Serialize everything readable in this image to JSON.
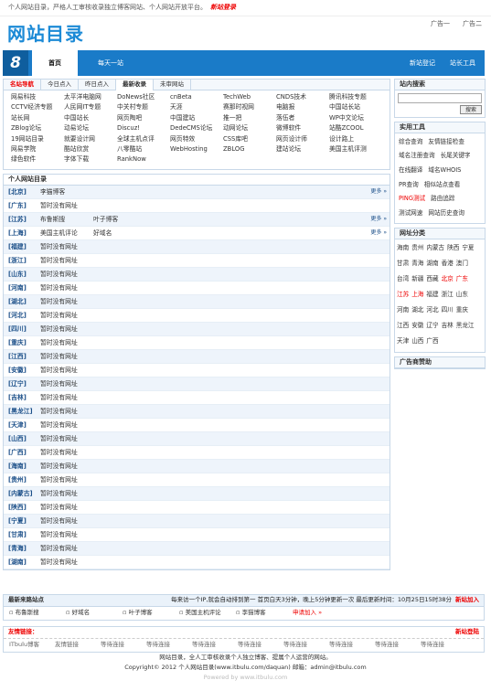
{
  "topbar": {
    "text": "个人网站目录，严格人工审核收录独立博客网站、个人网站开放平台。",
    "login": "新站登录"
  },
  "header": {
    "logo": "网站目录",
    "ad1": "广告一",
    "ad2": "广告二"
  },
  "nav": {
    "num": "8",
    "home": "首页",
    "daily": "每天一站",
    "submit": "新站登记",
    "tools": "站长工具"
  },
  "tabs": [
    "名站导航",
    "今日点入",
    "昨日点入",
    "最新收录",
    "未审网站"
  ],
  "famous": [
    "网易科技",
    "太平洋电脑网",
    "DoNews社区",
    "cnBeta",
    "TechWeb",
    "CNDS技术",
    "腾讯科技专题",
    "CCTV经济专题",
    "人民网IT专题",
    "中关村专题",
    "天涯",
    "赛那时视网",
    "电脑报",
    "中国站长站",
    "站长网",
    "中国站长",
    "网页陶吧",
    "中国建站",
    "推一把",
    "落伍者",
    "WP中文论坛",
    "ZBlog论坛",
    "动易论坛",
    "Discuz!",
    "DedeCMS论坛",
    "动网论坛",
    "微博软件",
    "站酷ZCOOL",
    "19网站目录",
    "就要设计网",
    "全球主机点评",
    "网页特效",
    "CSS库吧",
    "网页设计师",
    "设计路上",
    "网易学院",
    "酷站欣赏",
    "八零酷站",
    "WebHosting",
    "ZBLOG",
    "建站论坛",
    "美国主机评测",
    "绿色软件",
    "字体下载",
    "RankNow"
  ],
  "personal": {
    "title": "个人网站目录",
    "more": "更多 »",
    "rows": [
      {
        "p": "[北京]",
        "sites": [
          "李猫博客"
        ],
        "more": true
      },
      {
        "p": "[广东]",
        "sites": [
          "暂时没有网址"
        ],
        "more": false
      },
      {
        "p": "[江苏]",
        "sites": [
          "布鲁斯搜",
          "叶子博客"
        ],
        "more": true
      },
      {
        "p": "[上海]",
        "sites": [
          "美国主机评论",
          "好域名"
        ],
        "more": true
      },
      {
        "p": "[福建]",
        "sites": [
          "暂时没有网址"
        ],
        "more": false
      },
      {
        "p": "[浙江]",
        "sites": [
          "暂时没有网址"
        ],
        "more": false
      },
      {
        "p": "[山东]",
        "sites": [
          "暂时没有网址"
        ],
        "more": false
      },
      {
        "p": "[河南]",
        "sites": [
          "暂时没有网址"
        ],
        "more": false
      },
      {
        "p": "[湖北]",
        "sites": [
          "暂时没有网址"
        ],
        "more": false
      },
      {
        "p": "[河北]",
        "sites": [
          "暂时没有网址"
        ],
        "more": false
      },
      {
        "p": "[四川]",
        "sites": [
          "暂时没有网址"
        ],
        "more": false
      },
      {
        "p": "[重庆]",
        "sites": [
          "暂时没有网址"
        ],
        "more": false
      },
      {
        "p": "[江西]",
        "sites": [
          "暂时没有网址"
        ],
        "more": false
      },
      {
        "p": "[安徽]",
        "sites": [
          "暂时没有网址"
        ],
        "more": false
      },
      {
        "p": "[辽宁]",
        "sites": [
          "暂时没有网址"
        ],
        "more": false
      },
      {
        "p": "[吉林]",
        "sites": [
          "暂时没有网址"
        ],
        "more": false
      },
      {
        "p": "[黑龙江]",
        "sites": [
          "暂时没有网址"
        ],
        "more": false
      },
      {
        "p": "[天津]",
        "sites": [
          "暂时没有网址"
        ],
        "more": false
      },
      {
        "p": "[山西]",
        "sites": [
          "暂时没有网址"
        ],
        "more": false
      },
      {
        "p": "[广西]",
        "sites": [
          "暂时没有网址"
        ],
        "more": false
      },
      {
        "p": "[海南]",
        "sites": [
          "暂时没有网址"
        ],
        "more": false
      },
      {
        "p": "[贵州]",
        "sites": [
          "暂时没有网址"
        ],
        "more": false
      },
      {
        "p": "[内蒙古]",
        "sites": [
          "暂时没有网址"
        ],
        "more": false
      },
      {
        "p": "[陕西]",
        "sites": [
          "暂时没有网址"
        ],
        "more": false
      },
      {
        "p": "[宁夏]",
        "sites": [
          "暂时没有网址"
        ],
        "more": false
      },
      {
        "p": "[甘肃]",
        "sites": [
          "暂时没有网址"
        ],
        "more": false
      },
      {
        "p": "[青海]",
        "sites": [
          "暂时没有网址"
        ],
        "more": false
      },
      {
        "p": "[湖南]",
        "sites": [
          "暂时没有网址"
        ],
        "more": false
      }
    ]
  },
  "newsite": {
    "title": "最新来路站点",
    "scroll": "每来访一个IP,就会自动排到第一 首页白天3分钟，晚上5分钟更新一次 最后更新时间：10月25日15时38分",
    "add": "新站加入",
    "items": [
      "布鲁斯搜",
      "好域名",
      "叶子博客",
      "美国主机评论",
      "李猫博客"
    ],
    "apply": "申请加入 »"
  },
  "friend": {
    "title": "友情链接：",
    "reg": "新站登陆",
    "items": [
      "ITbulu博客",
      "友情链接",
      "等待连接",
      "等待连接",
      "等待连接",
      "等待连接",
      "等待连接",
      "等待连接",
      "等待连接",
      "等待连接"
    ]
  },
  "footer": {
    "l1": "网站目录，全人工审核收录个人独立博客、提属个人运营的网站。",
    "l2": "Copyright© 2012 个人网站目录(www.itbulu.com/daquan) 邮箱：admin@itbulu.com",
    "l3": "Powered by www.itbulu.com"
  },
  "side": {
    "search": "站内搜索",
    "search_btn": "搜索",
    "tools_title": "实用工具",
    "tools": [
      [
        "综合查询",
        "友情链接检查"
      ],
      [
        "域名注册查询",
        "长尾关键字"
      ],
      [
        "在线翻译",
        "域名WHOIS"
      ],
      [
        "PR查询",
        "相似站点查看"
      ],
      [
        "PING测试",
        "路由追踪"
      ],
      [
        "测试网速",
        "网站历史查询"
      ]
    ],
    "area_title": "网址分类",
    "areas": [
      [
        "海南",
        "贵州",
        "内蒙古",
        "陕西",
        "宁夏"
      ],
      [
        "甘肃",
        "青海",
        "湖南",
        "香港",
        "澳门"
      ],
      [
        "台湾",
        "新疆",
        "西藏",
        "北京",
        "广东"
      ],
      [
        "江苏",
        "上海",
        "福建",
        "浙江",
        "山东"
      ],
      [
        "河南",
        "湖北",
        "河北",
        "四川",
        "重庆"
      ],
      [
        "江西",
        "安徽",
        "辽宁",
        "吉林",
        "黑龙江"
      ],
      [
        "天津",
        "山西",
        "广西"
      ]
    ],
    "ad_title": "广告商赞助"
  }
}
